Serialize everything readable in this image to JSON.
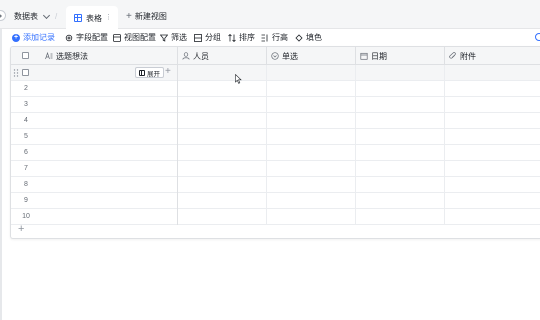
{
  "topbar": {
    "datatable_label": "数据表",
    "separator": "/",
    "active_view_tab": "表格",
    "tab_more": "⋮",
    "new_view_label": "新建视图"
  },
  "toolbar": {
    "add_record": "添加记录",
    "field_config": "字段配置",
    "view_config": "视图配置",
    "filter": "筛选",
    "group": "分组",
    "sort": "排序",
    "row_height": "行高",
    "fill_color": "填色",
    "accent_color": "#3370ff"
  },
  "grid": {
    "columns": [
      {
        "label": "选题想法",
        "icon": "text-field-icon"
      },
      {
        "label": "人员",
        "icon": "person-icon"
      },
      {
        "label": "单选",
        "icon": "single-select-icon"
      },
      {
        "label": "日期",
        "icon": "calendar-icon"
      },
      {
        "label": "附件",
        "icon": "attachment-icon"
      }
    ],
    "expand_label": "展开",
    "row_numbers": [
      "2",
      "3",
      "4",
      "5",
      "6",
      "7",
      "8",
      "9",
      "10"
    ]
  }
}
